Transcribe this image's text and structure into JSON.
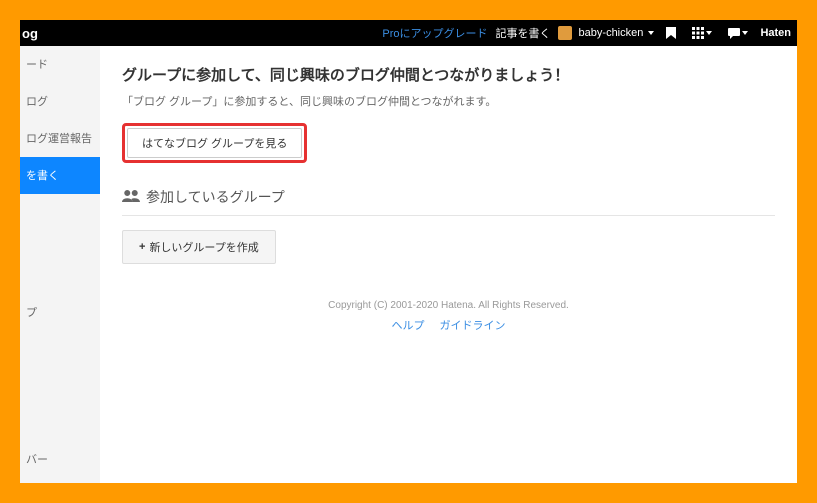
{
  "topbar": {
    "logo_fragment": "og",
    "upgrade_label": "Proにアップグレード",
    "write_label": "記事を書く",
    "username": "baby-chicken",
    "brand_right": "Haten"
  },
  "sidebar": {
    "items": [
      {
        "label": "ード"
      },
      {
        "label": "ログ"
      },
      {
        "label": "ログ運営報告"
      },
      {
        "label": "を書く",
        "active": true
      },
      {
        "label": "プ"
      },
      {
        "label": "バー"
      }
    ]
  },
  "main": {
    "title": "グループに参加して、同じ興味のブログ仲間とつながりましょう！",
    "description": "「ブログ グループ」に参加すると、同じ興味のブログ仲間とつながれます。",
    "view_groups_label": "はてなブログ グループを見る",
    "section_heading": "参加しているグループ",
    "create_group_label": "新しいグループを作成"
  },
  "footer": {
    "copyright": "Copyright (C) 2001-2020 Hatena. All Rights Reserved.",
    "help_label": "ヘルプ",
    "guideline_label": "ガイドライン"
  }
}
